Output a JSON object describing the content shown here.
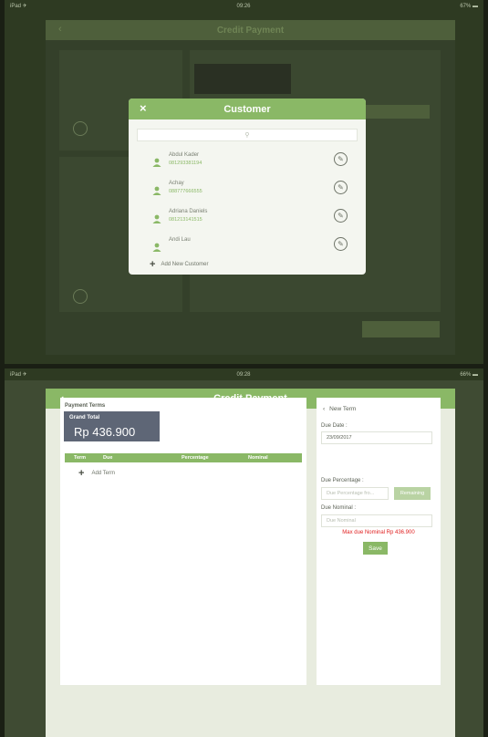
{
  "screen1": {
    "status": {
      "left": "iPad ✈",
      "time": "09:26",
      "right": "67% ▬"
    },
    "bg_title": "Credit Payment",
    "modal": {
      "title": "Customer",
      "close_icon": "×",
      "search_icon": "⚲",
      "edit_icon": "✎",
      "customers": [
        {
          "name": "Abdul Kader",
          "phone": "081293381194"
        },
        {
          "name": "Achay",
          "phone": "088777666555"
        },
        {
          "name": "Adriana Daniels",
          "phone": "081213141515"
        },
        {
          "name": "Andi Lau",
          "phone": ""
        }
      ],
      "add_label": "Add New Customer"
    }
  },
  "screen2": {
    "status": {
      "left": "iPad ✈",
      "time": "09:28",
      "right": "66% ▬"
    },
    "title": "Credit Payment",
    "back_icon": "‹",
    "left": {
      "section": "Payment Terms",
      "grand_total_label": "Grand Total",
      "grand_total_value": "Rp 436.900",
      "columns": [
        "Term",
        "Due",
        "Percentage",
        "Nominal"
      ],
      "add_term": "Add Term"
    },
    "right": {
      "back_label": "New Term",
      "due_date_label": "Due Date :",
      "due_date_value": "23/09/2017",
      "due_pct_label": "Due Percentage :",
      "due_pct_placeholder": "Due Percentage fro...",
      "remaining_label": "Remaining",
      "due_nominal_label": "Due Nominal :",
      "due_nominal_placeholder": "Due Nominal",
      "warning": "Max due Nominal Rp 436.900",
      "save_label": "Save",
      "warning_color": "#e02020"
    },
    "colors": {
      "accent": "#8ab866",
      "grand_total_bg": "#5e6676"
    }
  }
}
